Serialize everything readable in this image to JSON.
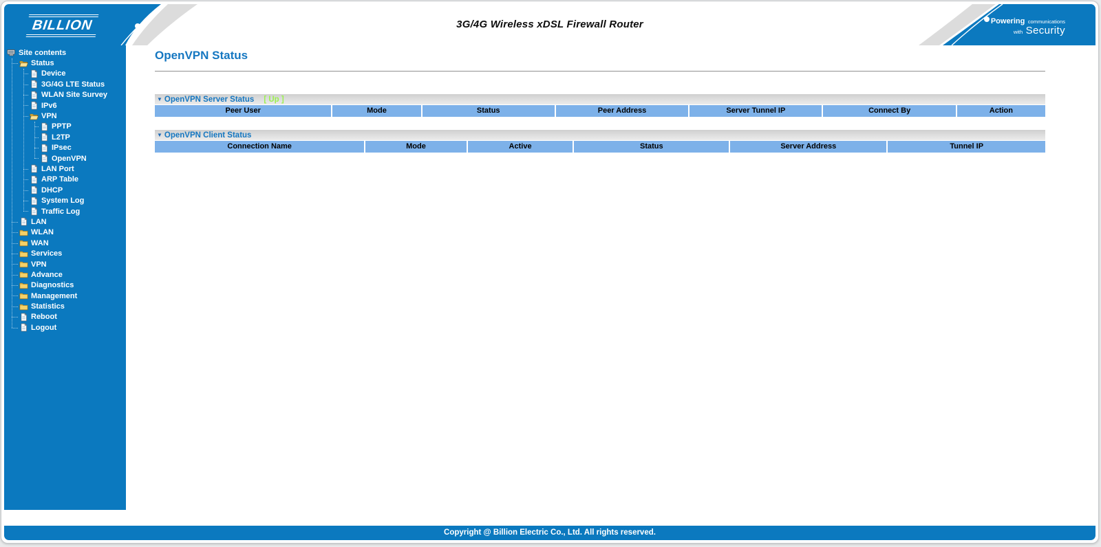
{
  "header": {
    "brand": "BILLION",
    "product_title": "3G/4G Wireless xDSL Firewall Router",
    "slogan": {
      "line1_bold": "Powering",
      "line1_rest": "communications",
      "line2_small": "with",
      "line2_big": "Security"
    }
  },
  "sidebar": {
    "items": [
      {
        "label": "Site contents",
        "icon": "computer-icon",
        "level": 0
      },
      {
        "label": "Status",
        "icon": "folder-open-icon",
        "level": 1
      },
      {
        "label": "Device",
        "icon": "document-icon",
        "level": 2
      },
      {
        "label": "3G/4G LTE Status",
        "icon": "document-icon",
        "level": 2
      },
      {
        "label": "WLAN Site Survey",
        "icon": "document-icon",
        "level": 2
      },
      {
        "label": "IPv6",
        "icon": "document-icon",
        "level": 2
      },
      {
        "label": "VPN",
        "icon": "folder-open-icon",
        "level": 2
      },
      {
        "label": "PPTP",
        "icon": "document-icon",
        "level": 3
      },
      {
        "label": "L2TP",
        "icon": "document-icon",
        "level": 3
      },
      {
        "label": "IPsec",
        "icon": "document-icon",
        "level": 3
      },
      {
        "label": "OpenVPN",
        "icon": "document-icon",
        "level": 3
      },
      {
        "label": "LAN Port",
        "icon": "document-icon",
        "level": 2
      },
      {
        "label": "ARP Table",
        "icon": "document-icon",
        "level": 2
      },
      {
        "label": "DHCP",
        "icon": "document-icon",
        "level": 2
      },
      {
        "label": "System Log",
        "icon": "document-icon",
        "level": 2
      },
      {
        "label": "Traffic Log",
        "icon": "document-icon",
        "level": 2
      },
      {
        "label": "LAN",
        "icon": "document-icon",
        "level": 1
      },
      {
        "label": "WLAN",
        "icon": "folder-icon",
        "level": 1
      },
      {
        "label": "WAN",
        "icon": "folder-icon",
        "level": 1
      },
      {
        "label": "Services",
        "icon": "folder-icon",
        "level": 1
      },
      {
        "label": "VPN",
        "icon": "folder-icon",
        "level": 1
      },
      {
        "label": "Advance",
        "icon": "folder-icon",
        "level": 1
      },
      {
        "label": "Diagnostics",
        "icon": "folder-icon",
        "level": 1
      },
      {
        "label": "Management",
        "icon": "folder-icon",
        "level": 1
      },
      {
        "label": "Statistics",
        "icon": "folder-icon",
        "level": 1
      },
      {
        "label": "Reboot",
        "icon": "document-icon",
        "level": 1
      },
      {
        "label": "Logout",
        "icon": "document-icon",
        "level": 1
      }
    ]
  },
  "main": {
    "page_title": "OpenVPN Status",
    "sections": [
      {
        "arrow": "▼",
        "title": "OpenVPN Server Status",
        "badge": "[ Up ]",
        "columns": [
          "Peer User",
          "Mode",
          "Status",
          "Peer Address",
          "Server Tunnel IP",
          "Connect By",
          "Action"
        ],
        "rows": []
      },
      {
        "arrow": "▼",
        "title": "OpenVPN Client Status",
        "badge": "",
        "columns": [
          "Connection Name",
          "Mode",
          "Active",
          "Status",
          "Server Address",
          "Tunnel IP"
        ],
        "rows": []
      }
    ]
  },
  "footer": {
    "copyright": "Copyright @ Billion Electric Co., Ltd. All rights reserved."
  },
  "colors": {
    "primary_blue": "#0b79bf",
    "table_header_blue": "#7db1e9",
    "heading_blue": "#1577c1",
    "status_up_green": "#9cf150",
    "swoosh_gray": "#dcdcdc"
  }
}
